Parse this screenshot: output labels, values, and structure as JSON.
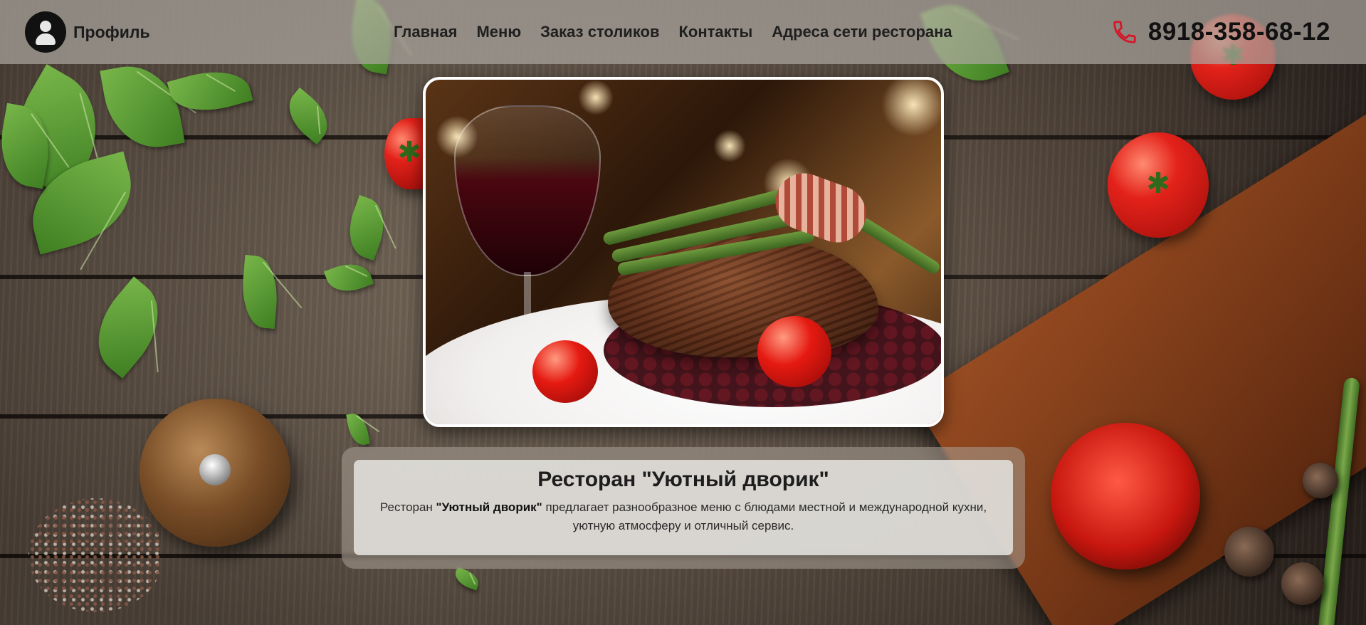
{
  "header": {
    "profile_label": "Профиль",
    "nav": [
      {
        "label": "Главная"
      },
      {
        "label": "Меню"
      },
      {
        "label": "Заказ столиков"
      },
      {
        "label": "Контакты"
      },
      {
        "label": "Адреса сети ресторана"
      }
    ],
    "phone": "8918-358-68-12"
  },
  "hero": {
    "image": "steak-with-asparagus-and-wine"
  },
  "about": {
    "title": "Ресторан \"Уютный дворик\"",
    "text_prefix": "Ресторан ",
    "name": "\"Уютный дворик\"",
    "text_suffix": " предлагает разнообразное меню с блюдами местной и международной кухни, уютную атмосферу и отличный сервис."
  },
  "icons": {
    "avatar": "user-icon",
    "phone": "phone-icon"
  },
  "colors": {
    "header_bg": "#aaa59e",
    "text": "#1f1f1f",
    "phone_icon": "#d3182a",
    "card_bg": "#e4e1de"
  }
}
